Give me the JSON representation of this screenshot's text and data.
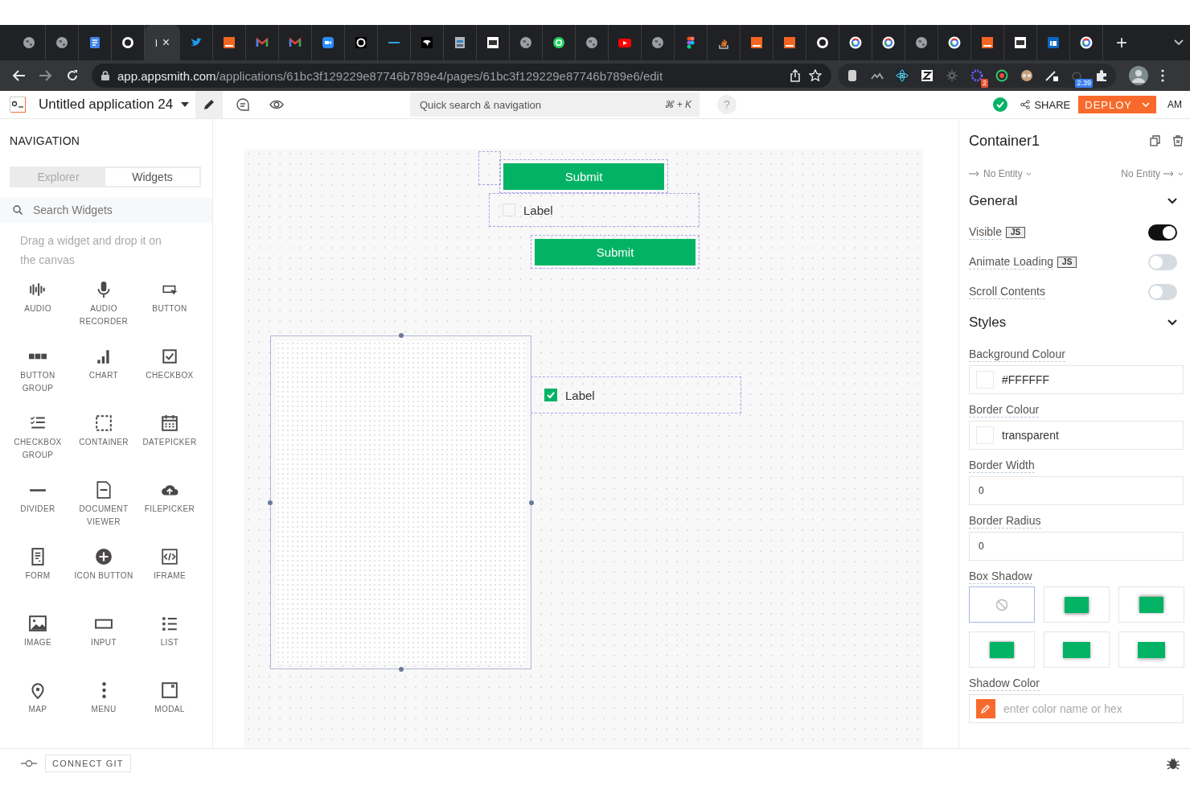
{
  "browser": {
    "tabs": [
      {
        "kind": "globe",
        "selected": false
      },
      {
        "kind": "globe",
        "selected": false
      },
      {
        "kind": "doc",
        "selected": false
      },
      {
        "kind": "github",
        "selected": false
      },
      {
        "kind": "blank",
        "selected": true,
        "title": "l",
        "close": "×"
      },
      {
        "kind": "bird",
        "selected": false
      },
      {
        "kind": "orange",
        "selected": false
      },
      {
        "kind": "mail",
        "selected": false
      },
      {
        "kind": "mail",
        "selected": false
      },
      {
        "kind": "video",
        "selected": false
      },
      {
        "kind": "ring",
        "selected": false
      },
      {
        "kind": "line",
        "selected": false
      },
      {
        "kind": "dark",
        "selected": false
      },
      {
        "kind": "building",
        "selected": false
      },
      {
        "kind": "paper",
        "selected": false
      },
      {
        "kind": "globe",
        "selected": false
      },
      {
        "kind": "chat",
        "selected": false
      },
      {
        "kind": "globe",
        "selected": false
      },
      {
        "kind": "play",
        "selected": false
      },
      {
        "kind": "globe",
        "selected": false
      },
      {
        "kind": "dots",
        "selected": false
      },
      {
        "kind": "stack",
        "selected": false
      },
      {
        "kind": "orange",
        "selected": false
      },
      {
        "kind": "orange",
        "selected": false
      },
      {
        "kind": "github",
        "selected": false
      },
      {
        "kind": "google",
        "selected": false
      },
      {
        "kind": "google",
        "selected": false
      },
      {
        "kind": "globe",
        "selected": false
      },
      {
        "kind": "google",
        "selected": false
      },
      {
        "kind": "orange",
        "selected": false
      },
      {
        "kind": "paper",
        "selected": false
      },
      {
        "kind": "square",
        "selected": false
      },
      {
        "kind": "google",
        "selected": false
      }
    ],
    "new_tab": "+",
    "url_host": "app.appsmith.com",
    "url_path": "/applications/61bc3f129229e87746b789e4/pages/61bc3f129229e87746b789e6/edit",
    "extensions": [
      {
        "kind": "cylinder"
      },
      {
        "kind": "peaks"
      },
      {
        "kind": "atom"
      },
      {
        "kind": "tile"
      },
      {
        "kind": "sun"
      },
      {
        "kind": "star",
        "badge": "2"
      },
      {
        "kind": "ring"
      },
      {
        "kind": "round"
      },
      {
        "kind": "pen"
      },
      {
        "kind": "timer",
        "badge": "2.39"
      },
      {
        "kind": "puzzle"
      }
    ]
  },
  "header": {
    "app_name": "Untitled application 24",
    "modes": [
      {
        "kind": "edit",
        "selected": true
      },
      {
        "kind": "comment",
        "selected": false
      },
      {
        "kind": "view",
        "selected": false
      }
    ],
    "search": {
      "placeholder": "Quick search & navigation",
      "shortcut": "⌘ + K"
    },
    "help": "?",
    "share": "SHARE",
    "deploy": "DEPLOY",
    "avatar": "AM"
  },
  "sidebar": {
    "title": "NAVIGATION",
    "tabs": [
      {
        "label": "Explorer",
        "selected": false
      },
      {
        "label": "Widgets",
        "selected": true
      }
    ],
    "search": {
      "placeholder": "Search Widgets"
    },
    "hint": "Drag a widget and drop it on the canvas",
    "widgets": [
      {
        "kind": "audio",
        "label": "AUDIO"
      },
      {
        "kind": "mic",
        "label": "AUDIO RECORDER"
      },
      {
        "kind": "button",
        "label": "BUTTON"
      },
      {
        "kind": "button_group",
        "label": "BUTTON GROUP"
      },
      {
        "kind": "chart",
        "label": "CHART"
      },
      {
        "kind": "checkbox",
        "label": "CHECKBOX"
      },
      {
        "kind": "checkbox_group",
        "label": "CHECKBOX GROUP"
      },
      {
        "kind": "container",
        "label": "CONTAINER"
      },
      {
        "kind": "datepicker",
        "label": "DATEPICKER"
      },
      {
        "kind": "divider",
        "label": "DIVIDER"
      },
      {
        "kind": "document",
        "label": "DOCUMENT VIEWER"
      },
      {
        "kind": "cloud",
        "label": "FILEPICKER"
      },
      {
        "kind": "form",
        "label": "FORM"
      },
      {
        "kind": "icon_button",
        "label": "ICON BUTTON"
      },
      {
        "kind": "iframe",
        "label": "IFRAME"
      },
      {
        "kind": "image",
        "label": "IMAGE"
      },
      {
        "kind": "input",
        "label": "INPUT"
      },
      {
        "kind": "list",
        "label": "LIST"
      },
      {
        "kind": "map",
        "label": "MAP"
      },
      {
        "kind": "menu",
        "label": "MENU"
      },
      {
        "kind": "modal",
        "label": "MODAL"
      }
    ]
  },
  "canvas": {
    "widgets": [
      {
        "kind": "empty"
      },
      {
        "kind": "button",
        "label": "Submit"
      },
      {
        "kind": "checkbox",
        "label": "Label",
        "checked": false
      },
      {
        "kind": "button",
        "label": "Submit"
      },
      {
        "kind": "container"
      },
      {
        "kind": "checkbox",
        "label": "Label",
        "checked": true
      }
    ]
  },
  "properties": {
    "title": "Container1",
    "incoming": "No Entity",
    "outgoing": "No Entity",
    "sections": [
      {
        "title": "General",
        "expanded": true,
        "rows": [
          {
            "kind": "toggle",
            "label": "Visible",
            "js": "JS",
            "on": true
          },
          {
            "kind": "toggle",
            "label": "Animate Loading",
            "js": "JS",
            "on": false
          },
          {
            "kind": "toggle",
            "label": "Scroll Contents",
            "on": false
          }
        ]
      },
      {
        "title": "Styles",
        "expanded": true,
        "rows": [
          {
            "kind": "color",
            "label": "Background Colour",
            "value": "#FFFFFF"
          },
          {
            "kind": "color",
            "label": "Border Colour",
            "value": "transparent"
          },
          {
            "kind": "text",
            "label": "Border Width",
            "value": "0"
          },
          {
            "kind": "text",
            "label": "Border Radius",
            "value": "0"
          },
          {
            "kind": "shadow",
            "label": "Box Shadow",
            "options": [
              {
                "kind": "none",
                "selected": true
              },
              {
                "kind": "bottom",
                "selected": false
              },
              {
                "kind": "top",
                "selected": false
              },
              {
                "kind": "small",
                "selected": false
              },
              {
                "kind": "medium",
                "selected": false
              },
              {
                "kind": "large",
                "selected": false
              }
            ]
          },
          {
            "kind": "picker",
            "label": "Shadow Color",
            "placeholder": "enter color name or hex"
          }
        ]
      }
    ]
  },
  "footer": {
    "git": "CONNECT GIT"
  }
}
